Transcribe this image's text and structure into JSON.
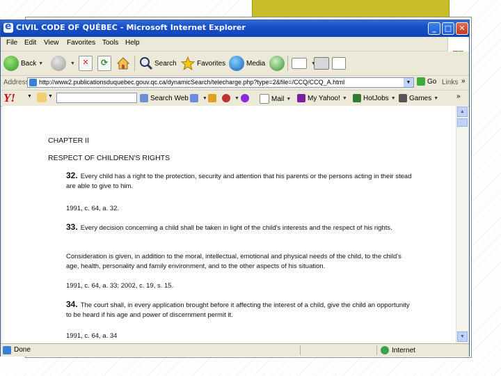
{
  "window": {
    "title": "CIVIL CODE OF QUÉBEC - Microsoft Internet Explorer"
  },
  "menu": [
    "File",
    "Edit",
    "View",
    "Favorites",
    "Tools",
    "Help"
  ],
  "toolbar": {
    "back_label": "Back",
    "search_label": "Search",
    "favorites_label": "Favorites",
    "media_label": "Media"
  },
  "address": {
    "label": "Address",
    "url": "http://www2.publicationsduquebec.gouv.qc.ca/dynamicSearch/telecharge.php?type=2&file=/CCQ/CCQ_A.html",
    "go_label": "Go",
    "links_label": "Links"
  },
  "yahoo": {
    "search_web_label": "Search Web",
    "mail_label": "Mail",
    "myyahoo_label": "My Yahoo!",
    "hotjobs_label": "HotJobs",
    "games_label": "Games"
  },
  "document": {
    "chapter": "CHAPTER II",
    "section_title": "RESPECT OF CHILDREN'S RIGHTS",
    "articles": [
      {
        "number": "32.",
        "text": "Every child has a right to the protection, security and attention that his parents or the persons acting in their stead are able to give to him.",
        "source": "1991, c. 64, a. 32."
      },
      {
        "number": "33.",
        "text": "Every decision concerning a child shall be taken in light of the child's interests and the respect of his rights.",
        "extra": "Consideration is given, in addition to the moral, intellectual, emotional and physical needs of the child, to the child's age, health, personality and family environment, and to the other aspects of his situation.",
        "source": "1991, c. 64, a. 33; 2002, c. 19, s. 15."
      },
      {
        "number": "34.",
        "text": "The court shall, in every application brought before it affecting the interest of a child, give the child an opportunity to be heard if his age and power of discernment permit it.",
        "source": "1991, c. 64, a. 34"
      }
    ]
  },
  "status": {
    "left": "Done",
    "zone": "Internet"
  }
}
